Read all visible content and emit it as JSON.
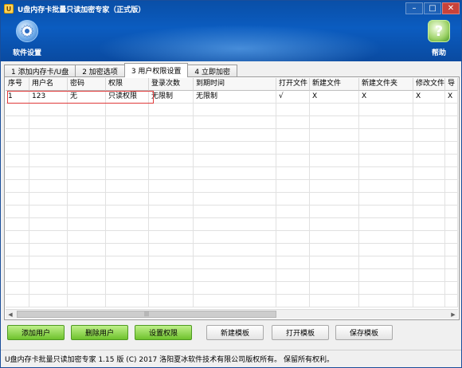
{
  "window": {
    "title": "U盘内存卡批量只读加密专家（正式版）",
    "logo_glyph": "U",
    "controls": {
      "minimize": "–",
      "maximize": "□",
      "close": "✕"
    }
  },
  "toolbar": {
    "settings_label": "软件设置",
    "settings_icon": "gear-icon",
    "help_label": "帮助",
    "help_icon": "help-icon",
    "help_glyph": "?"
  },
  "tabs": [
    {
      "label": "1 添加内存卡/U盘",
      "active": false
    },
    {
      "label": "2 加密选项",
      "active": false
    },
    {
      "label": "3 用户权限设置",
      "active": true
    },
    {
      "label": "4 立即加密",
      "active": false
    }
  ],
  "table": {
    "columns": [
      "序号",
      "用户名",
      "密码",
      "权限",
      "登录次数",
      "到期时间",
      "打开文件",
      "新建文件",
      "新建文件夹",
      "修改文件",
      "导"
    ],
    "rows": [
      [
        "1",
        "123",
        "无",
        "只读权限",
        "无限制",
        "无限制",
        "√",
        "X",
        "X",
        "X",
        "X"
      ]
    ]
  },
  "scrollbar": {
    "left_arrow": "◀",
    "right_arrow": "▶",
    "grip": "|||"
  },
  "buttons": {
    "add_user": "添加用户",
    "delete_user": "删除用户",
    "set_permission": "设置权限",
    "new_template": "新建模板",
    "open_template": "打开模板",
    "save_template": "保存模板"
  },
  "status": {
    "text": "U盘内存卡批量只读加密专家 1.15 版  (C)  2017 洛阳夏冰软件技术有限公司版权所有。 保留所有权利。"
  },
  "colors": {
    "banner": "#0b5cc0",
    "selection_outline": "#e03a3a",
    "green_button": "#6fc22d"
  }
}
